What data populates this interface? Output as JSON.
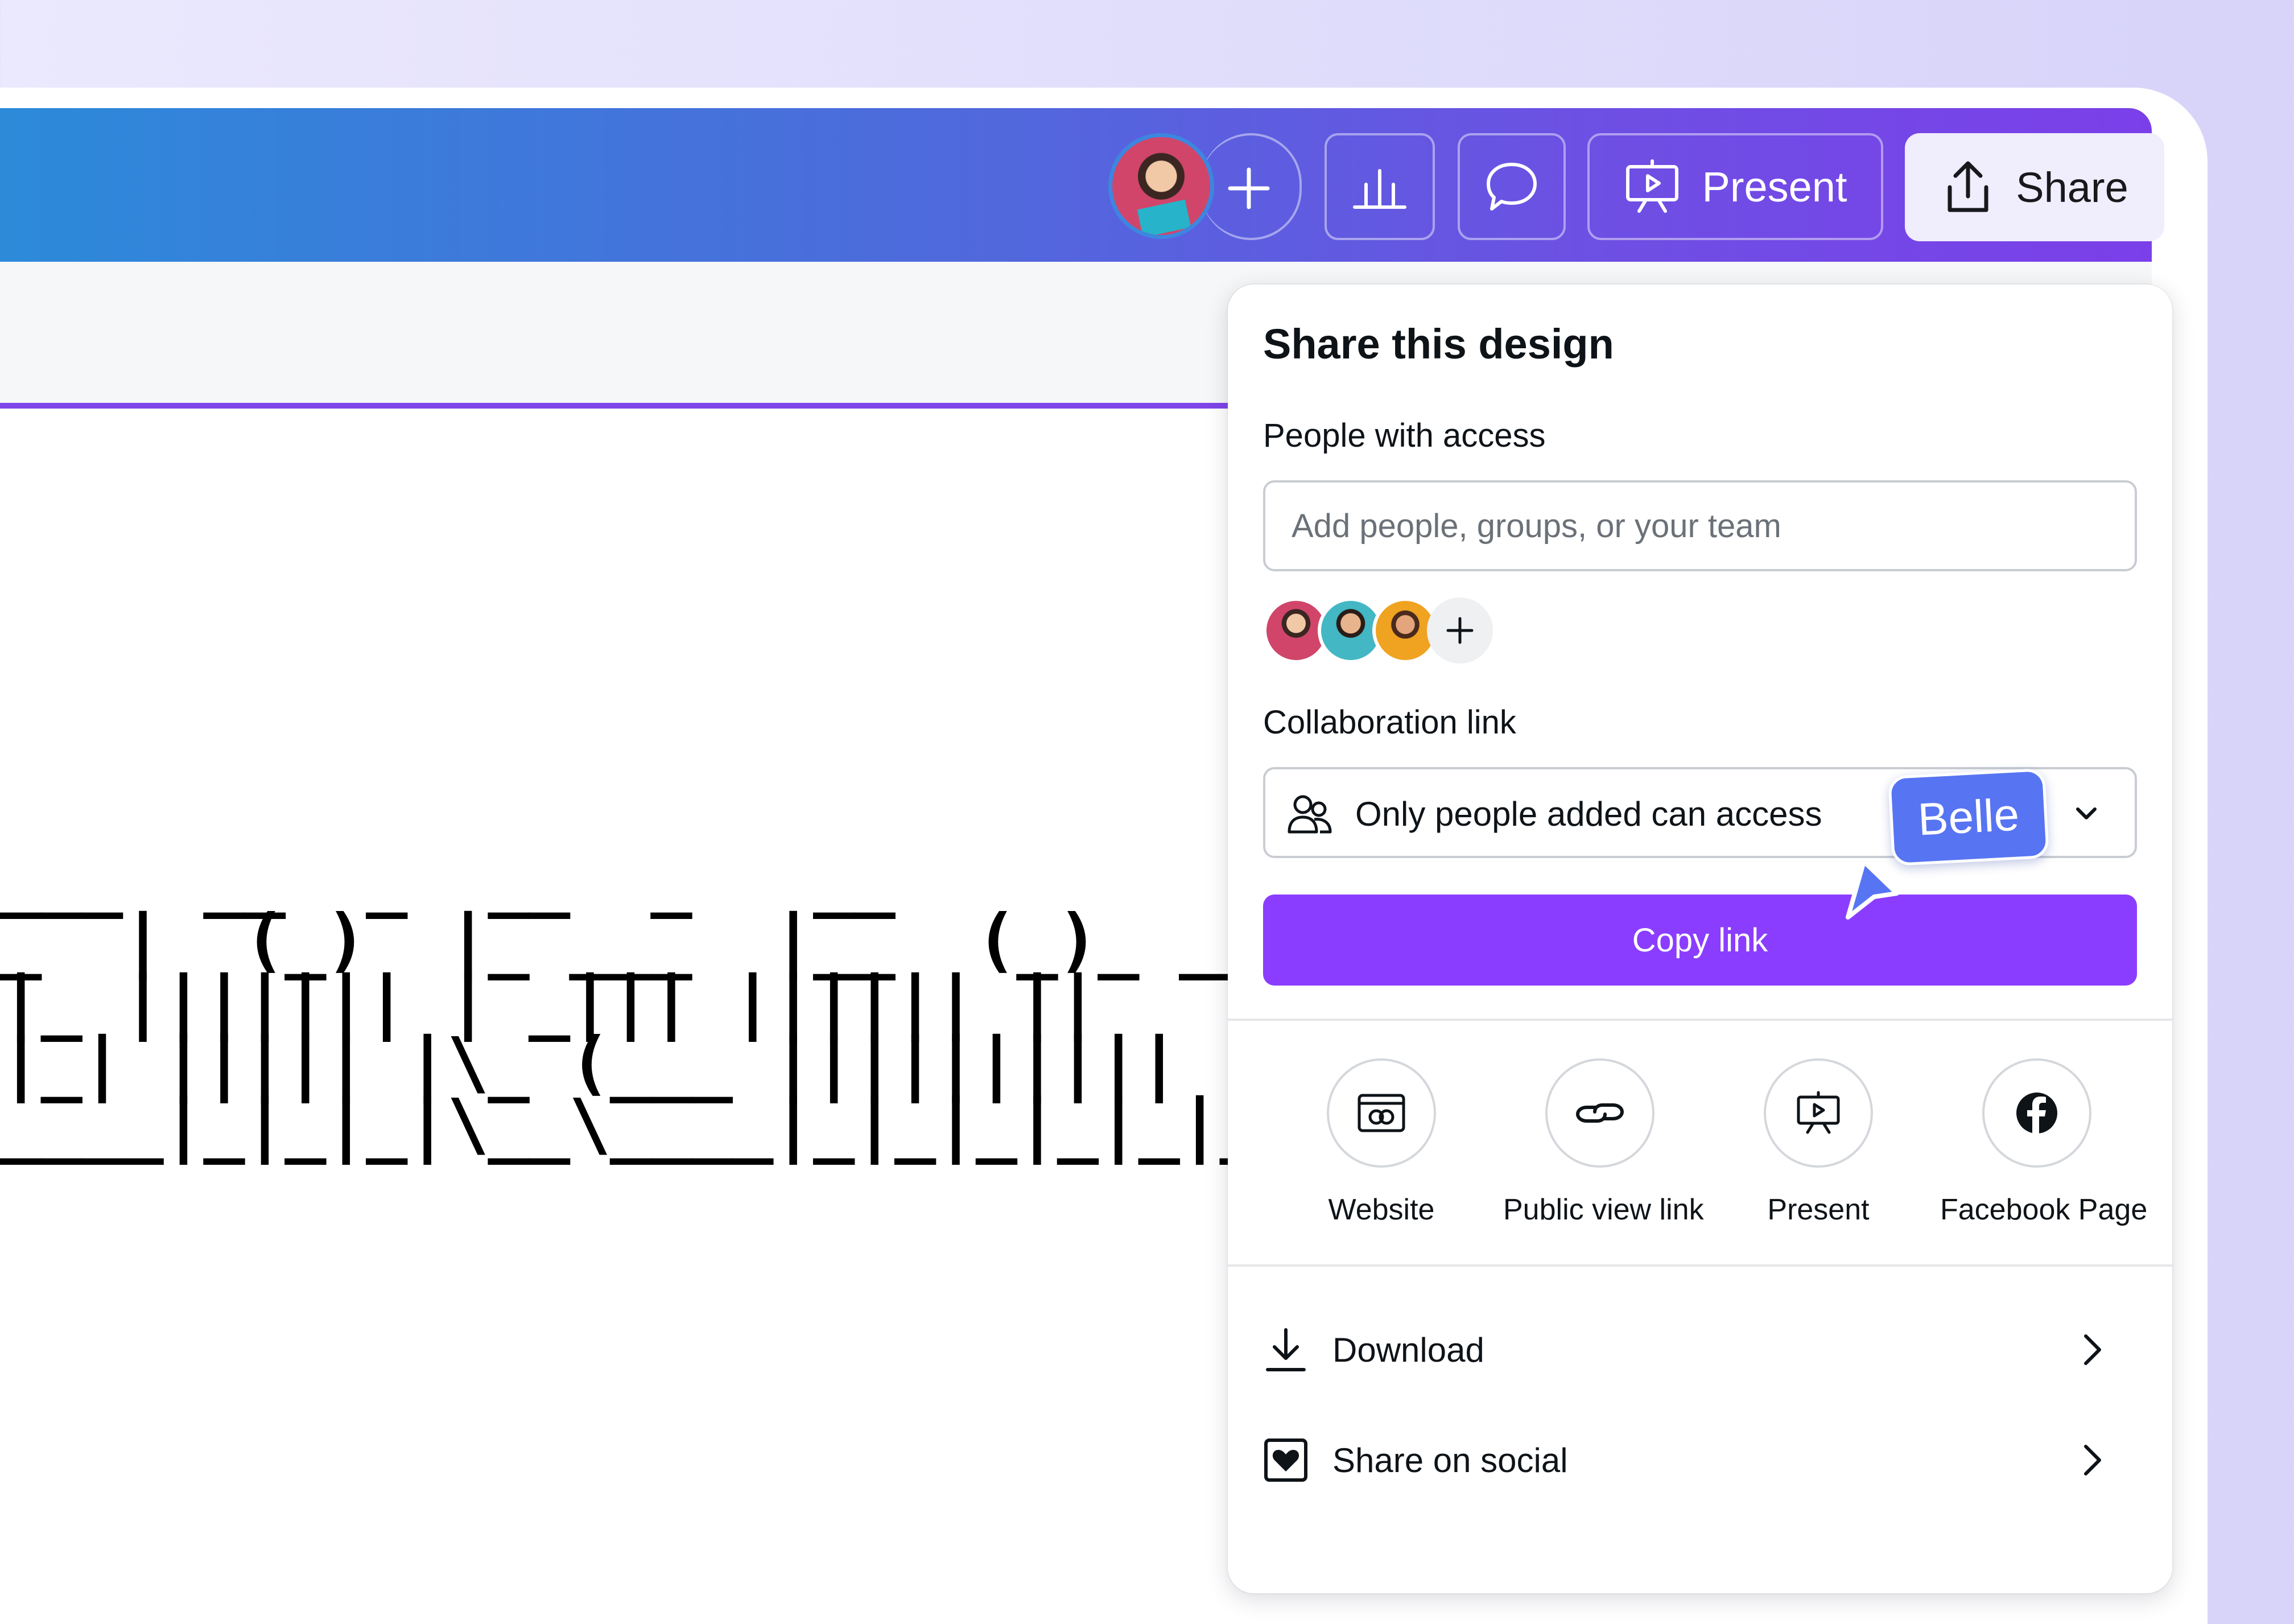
{
  "topbar": {
    "present_label": "Present",
    "share_label": "Share",
    "icons": [
      "add-collaborator-icon",
      "insights-icon",
      "comment-icon",
      "present-icon",
      "share-upload-icon"
    ]
  },
  "canvas": {
    "ascii_art": "___  __  _  __  _   __  \n_  |  (_)  |_ ___  |__  (_)_ __ \n|_ ||||||| | _||| |||||| ||\n|_| ||||| |\\_ (___ |||||||||| | |\n____|_|_|_|\\__\\____|_|_|_|_|_|_|_|"
  },
  "share_panel": {
    "title": "Share this design",
    "people_label": "People with access",
    "add_people_placeholder": "Add people, groups, or your team",
    "collab_label": "Collaboration link",
    "access_value": "Only people added can access",
    "copy_link_label": "Copy link",
    "options": [
      {
        "label": "Website",
        "icon": "website-icon"
      },
      {
        "label": "Public view link",
        "icon": "link-icon"
      },
      {
        "label": "Present",
        "icon": "present-icon"
      },
      {
        "label": "Facebook Page",
        "icon": "facebook-icon"
      }
    ],
    "rows": [
      {
        "label": "Download",
        "icon": "download-icon"
      },
      {
        "label": "Share on social",
        "icon": "social-heart-icon"
      }
    ]
  },
  "cursor": {
    "name": "Belle",
    "color": "#5774f2"
  },
  "colors": {
    "brand_purple": "#8b3dff",
    "topbar_start": "#2c8ad9",
    "topbar_end": "#7b3fe9"
  }
}
